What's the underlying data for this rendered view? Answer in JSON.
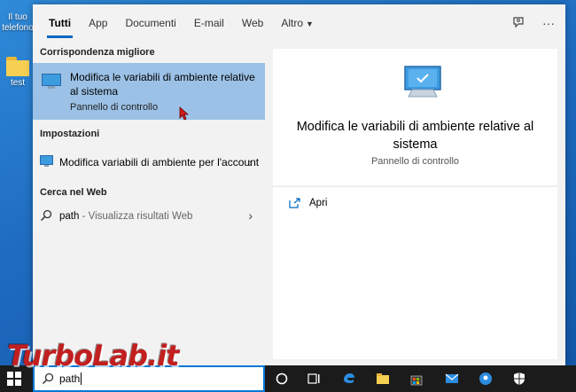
{
  "desktop": {
    "icons": [
      {
        "label": "Il tuo telefono"
      },
      {
        "label": "test"
      }
    ]
  },
  "search": {
    "tabs": [
      {
        "label": "Tutti",
        "active": true
      },
      {
        "label": "App"
      },
      {
        "label": "Documenti"
      },
      {
        "label": "E-mail"
      },
      {
        "label": "Web"
      },
      {
        "label": "Altro",
        "has_dropdown": true
      }
    ],
    "more_options": "···",
    "left": {
      "best_match_header": "Corrispondenza migliore",
      "best_match": {
        "title": "Modifica le variabili di ambiente relative al sistema",
        "subtitle": "Pannello di controllo",
        "icon": "monitor-icon"
      },
      "settings_header": "Impostazioni",
      "settings_item": {
        "title": "Modifica variabili di ambiente per l'account",
        "icon": "monitor-icon"
      },
      "web_header": "Cerca nel Web",
      "web_item": {
        "query": "path",
        "suffix": " - Visualizza risultati Web",
        "icon": "search-icon"
      }
    },
    "right": {
      "title": "Modifica le variabili di ambiente relative al sistema",
      "subtitle": "Pannello di controllo",
      "action_open": "Apri"
    },
    "query": "path"
  },
  "taskbar": {
    "icons": [
      "cortana-icon",
      "task-view-icon",
      "edge-icon",
      "file-explorer-icon",
      "store-icon",
      "mail-icon",
      "maps-icon",
      "security-icon"
    ]
  },
  "colors": {
    "accent": "#0078d7",
    "selection": "#9bc1e6",
    "desktop": "#1e6bc0"
  },
  "watermark": "TurboLab.it"
}
